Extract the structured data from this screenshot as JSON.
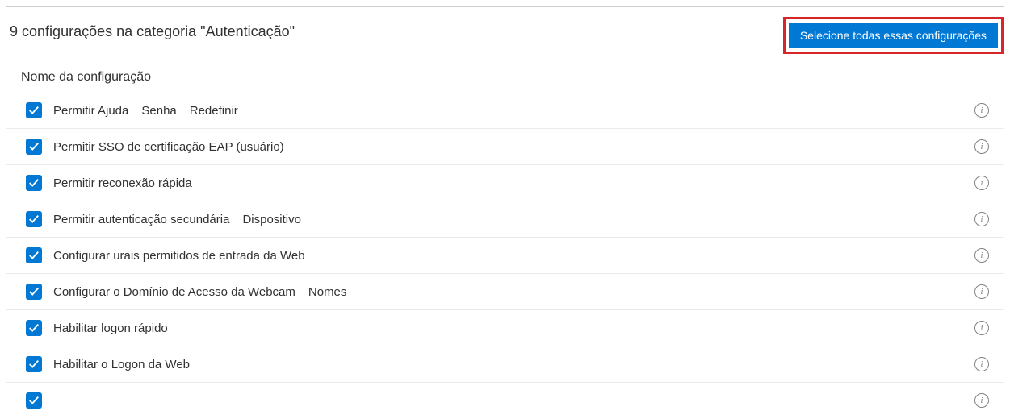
{
  "header": {
    "count": "9",
    "text": "configurações na categoria \"Autenticação\"",
    "select_all": "Selecione todas essas configurações"
  },
  "column_header": "Nome da configuração",
  "rows": [
    {
      "label": "Permitir Ajuda",
      "extra": "Senha",
      "extra2": "Redefinir"
    },
    {
      "label": "Permitir SSO de certificação EAP (usuário)",
      "extra": "",
      "extra2": ""
    },
    {
      "label": "Permitir reconexão rápida",
      "extra": "",
      "extra2": ""
    },
    {
      "label": "Permitir autenticação secundária",
      "extra": "Dispositivo",
      "extra2": ""
    },
    {
      "label": "Configurar urais permitidos de entrada da Web",
      "extra": "",
      "extra2": ""
    },
    {
      "label": "Configurar o Domínio de Acesso da Webcam",
      "extra": "Nomes",
      "extra2": ""
    },
    {
      "label": "Habilitar logon rápido",
      "extra": "",
      "extra2": ""
    },
    {
      "label": "Habilitar o Logon da Web",
      "extra": "",
      "extra2": ""
    },
    {
      "label": "",
      "extra": "",
      "extra2": ""
    }
  ]
}
